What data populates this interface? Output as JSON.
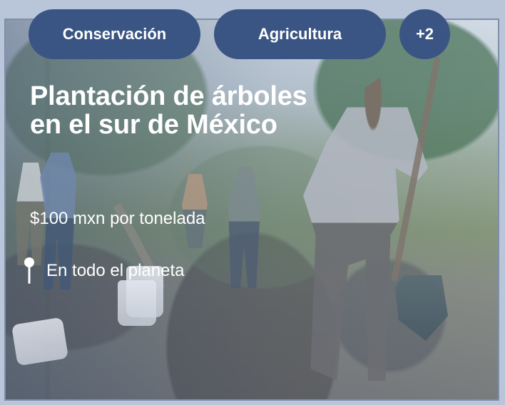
{
  "tags": {
    "conservation": "Conservación",
    "agriculture": "Agricultura",
    "more": "+2"
  },
  "card": {
    "title": "Plantación de árboles en el sur de México",
    "price": "$100 mxn por tonelada",
    "location": "En todo el planeta",
    "location_icon": "map-pin-icon"
  },
  "colors": {
    "tag_background": "#3a5583",
    "tag_text": "#ffffff",
    "overlay_text": "#ffffff",
    "card_background": "#b9c6da"
  }
}
